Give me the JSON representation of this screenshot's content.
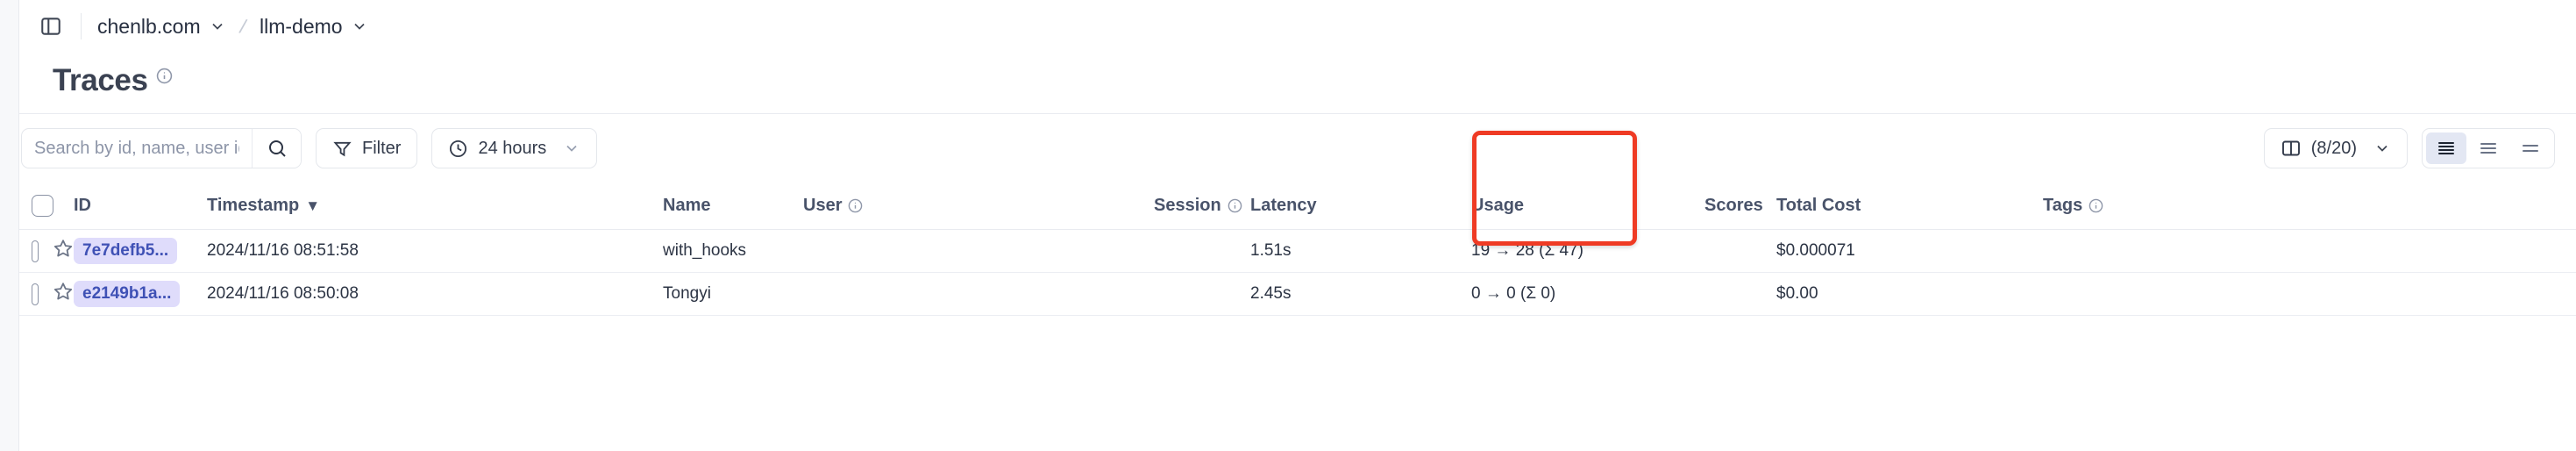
{
  "topbar": {
    "sidebar_toggle_icon": "panel-left-icon",
    "breadcrumbs": [
      {
        "label": "chenlb.com",
        "chevron": "chevron-down-icon"
      },
      {
        "label": "llm-demo",
        "chevron": "chevron-down-icon"
      }
    ],
    "separator": "/"
  },
  "page": {
    "title": "Traces",
    "title_info_icon": "info-icon"
  },
  "toolbar": {
    "search": {
      "placeholder": "Search by id, name, user id",
      "value": "",
      "button_icon": "search-icon"
    },
    "filter": {
      "label": "Filter",
      "icon": "funnel-icon"
    },
    "time_range": {
      "label": "24 hours",
      "icon": "clock-icon",
      "chevron": "chevron-down-icon"
    },
    "columns": {
      "label": "(8/20)",
      "icon": "columns-icon",
      "chevron": "chevron-down-icon"
    },
    "row_height": {
      "options": [
        {
          "name": "rows-dense-icon",
          "selected": true
        },
        {
          "name": "rows-normal-icon",
          "selected": false
        },
        {
          "name": "rows-tall-icon",
          "selected": false
        }
      ]
    }
  },
  "table": {
    "columns": [
      {
        "key": "select",
        "label": "",
        "info": false
      },
      {
        "key": "id",
        "label": "ID",
        "info": false
      },
      {
        "key": "timestamp",
        "label": "Timestamp",
        "info": false,
        "sort": "▼"
      },
      {
        "key": "name",
        "label": "Name",
        "info": false
      },
      {
        "key": "user",
        "label": "User",
        "info": true
      },
      {
        "key": "session",
        "label": "Session",
        "info": true
      },
      {
        "key": "latency",
        "label": "Latency",
        "info": false
      },
      {
        "key": "usage",
        "label": "Usage",
        "info": false
      },
      {
        "key": "scores",
        "label": "Scores",
        "info": false
      },
      {
        "key": "total_cost",
        "label": "Total Cost",
        "info": false
      },
      {
        "key": "tags",
        "label": "Tags",
        "info": true
      }
    ],
    "rows": [
      {
        "id": "7e7defb5...",
        "timestamp": "2024/11/16 08:51:58",
        "name": "with_hooks",
        "user": "",
        "session": "",
        "latency": "1.51s",
        "usage": "19 → 28 (Σ 47)",
        "scores": "",
        "total_cost": "$0.000071",
        "tags": ""
      },
      {
        "id": "e2149b1a...",
        "timestamp": "2024/11/16 08:50:08",
        "name": "Tongyi",
        "user": "",
        "session": "",
        "latency": "2.45s",
        "usage": "0 → 0 (Σ 0)",
        "scores": "",
        "total_cost": "$0.00",
        "tags": ""
      }
    ]
  },
  "annotation": {
    "name": "usage-column-highlight",
    "color": "#ef3b24"
  }
}
